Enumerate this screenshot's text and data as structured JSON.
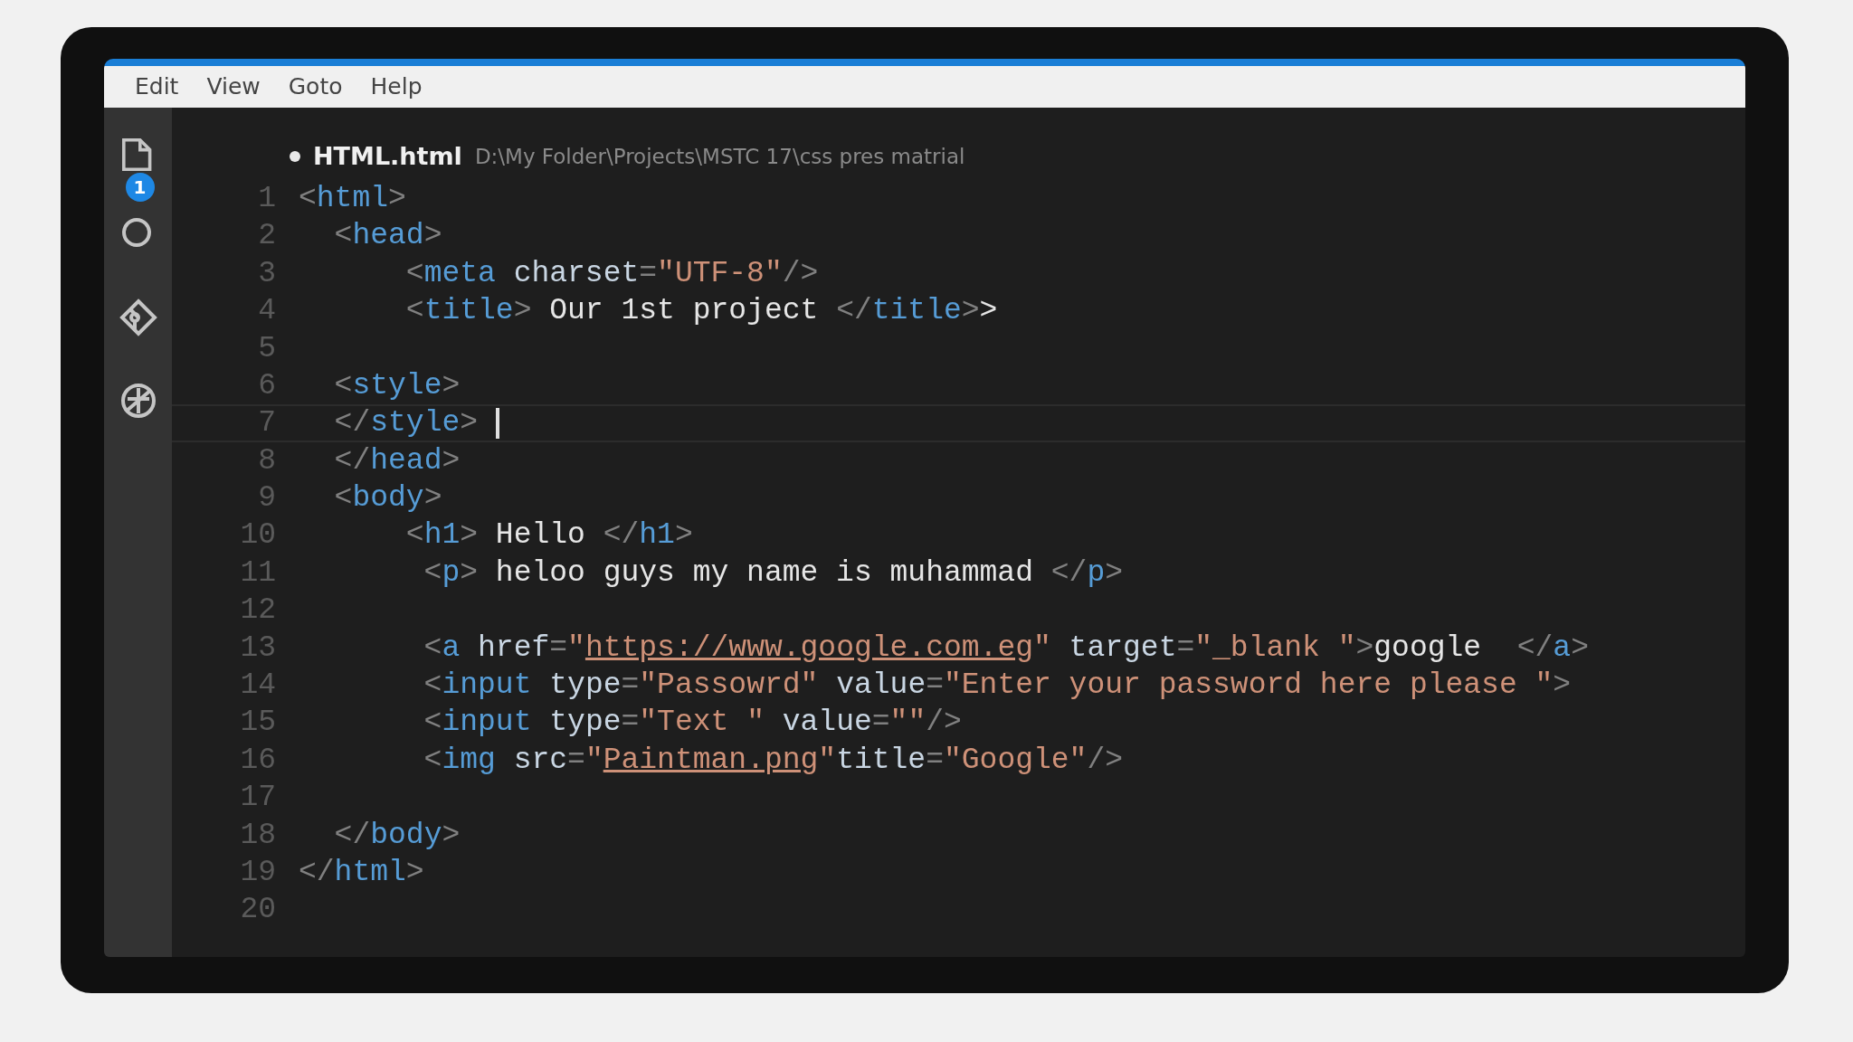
{
  "menu": [
    "Edit",
    "View",
    "Goto",
    "Help"
  ],
  "activity_bar": [
    {
      "kind": "files",
      "badge": "1"
    },
    {
      "kind": "search"
    },
    {
      "kind": "git"
    },
    {
      "kind": "debug"
    }
  ],
  "editor": {
    "modified": true,
    "file_name": "HTML.html",
    "path": "D:\\My Folder\\Projects\\MSTC 17\\css pres matrial",
    "lines": [
      {
        "number": "1",
        "current": false,
        "tokens": [
          {
            "punct": "<"
          },
          {
            "tag": "html"
          },
          {
            "punct": ">"
          }
        ]
      },
      {
        "number": "2",
        "current": false,
        "tokens": [
          {
            "punct": "  <"
          },
          {
            "tag": "head"
          },
          {
            "punct": ">"
          }
        ]
      },
      {
        "number": "3",
        "current": false,
        "tokens": [
          {
            "punct": "      <"
          },
          {
            "tag": "meta"
          },
          {
            "attr": " charset"
          },
          {
            "punct": "="
          },
          {
            "string": "\"UTF-8\""
          },
          {
            "punct": "/>"
          }
        ]
      },
      {
        "number": "4",
        "current": false,
        "tokens": [
          {
            "punct": "      <"
          },
          {
            "tag": "title"
          },
          {
            "punct": "> "
          },
          {
            "text": "Our 1st project "
          },
          {
            "punct": "</"
          },
          {
            "tag": "title"
          },
          {
            "punct": ">"
          },
          {
            "text": ">"
          }
        ]
      },
      {
        "number": "5",
        "current": false
      },
      {
        "number": "6",
        "current": false,
        "tokens": [
          {
            "punct": "  <"
          },
          {
            "tag": "style"
          },
          {
            "punct": ">"
          }
        ]
      },
      {
        "number": "7",
        "current": true,
        "tokens": [
          {
            "punct": "  </"
          },
          {
            "tag": "style"
          },
          {
            "punct": "> "
          }
        ]
      },
      {
        "number": "8",
        "current": false,
        "tokens": [
          {
            "punct": "  </"
          },
          {
            "tag": "head"
          },
          {
            "punct": ">"
          }
        ]
      },
      {
        "number": "9",
        "current": false,
        "tokens": [
          {
            "punct": "  <"
          },
          {
            "tag": "body"
          },
          {
            "punct": ">"
          }
        ]
      },
      {
        "number": "10",
        "current": false,
        "tokens": [
          {
            "punct": "      <"
          },
          {
            "tag": "h1"
          },
          {
            "punct": "> "
          },
          {
            "text": "Hello "
          },
          {
            "punct": "</"
          },
          {
            "tag": "h1"
          },
          {
            "punct": ">"
          }
        ]
      },
      {
        "number": "11",
        "current": false,
        "tokens": [
          {
            "punct": "       <"
          },
          {
            "tag": "p"
          },
          {
            "punct": "> "
          },
          {
            "text": "heloo guys my name is muhammad "
          },
          {
            "punct": "</"
          },
          {
            "tag": "p"
          },
          {
            "punct": ">"
          }
        ]
      },
      {
        "number": "12",
        "current": false
      },
      {
        "number": "13",
        "current": false,
        "tokens": [
          {
            "punct": "       <"
          },
          {
            "tag": "a"
          },
          {
            "attr": " href"
          },
          {
            "punct": "="
          },
          {
            "string": "\""
          },
          {
            "url": "https://www.google.com.eg"
          },
          {
            "string": "\""
          },
          {
            "attr": " target"
          },
          {
            "punct": "="
          },
          {
            "string": "\"_blank \""
          },
          {
            "punct": ">"
          },
          {
            "text": "google  "
          },
          {
            "punct": "</"
          },
          {
            "tag": "a"
          },
          {
            "punct": ">"
          }
        ]
      },
      {
        "number": "14",
        "current": false,
        "tokens": [
          {
            "punct": "       <"
          },
          {
            "tag": "input"
          },
          {
            "attr": " type"
          },
          {
            "punct": "="
          },
          {
            "string": "\"Passowrd\""
          },
          {
            "attr": " value"
          },
          {
            "punct": "="
          },
          {
            "string": "\"Enter your password here please \""
          },
          {
            "punct": ">"
          }
        ]
      },
      {
        "number": "15",
        "current": false,
        "tokens": [
          {
            "punct": "       <"
          },
          {
            "tag": "input"
          },
          {
            "attr": " type"
          },
          {
            "punct": "="
          },
          {
            "string": "\"Text \""
          },
          {
            "attr": " value"
          },
          {
            "punct": "="
          },
          {
            "string": "\"\""
          },
          {
            "punct": "/>"
          }
        ]
      },
      {
        "number": "16",
        "current": false,
        "tokens": [
          {
            "punct": "       <"
          },
          {
            "tag": "img"
          },
          {
            "attr": " src"
          },
          {
            "punct": "="
          },
          {
            "string": "\""
          },
          {
            "url": "Paintman.png"
          },
          {
            "string": "\""
          },
          {
            "attr": "title"
          },
          {
            "punct": "="
          },
          {
            "string": "\"Google\""
          },
          {
            "punct": "/>"
          }
        ]
      },
      {
        "number": "17",
        "current": false
      },
      {
        "number": "18",
        "current": false,
        "tokens": [
          {
            "punct": "  </"
          },
          {
            "tag": "body"
          },
          {
            "punct": ">"
          }
        ]
      },
      {
        "number": "19",
        "current": false,
        "tokens": [
          {
            "punct": "</"
          },
          {
            "tag": "html"
          },
          {
            "punct": ">"
          }
        ]
      },
      {
        "number": "20",
        "current": false
      }
    ]
  }
}
